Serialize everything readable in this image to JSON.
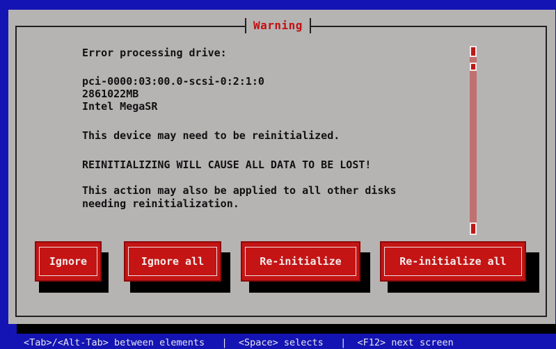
{
  "dialog": {
    "title": "Warning",
    "message_lines": [
      "Error processing drive:",
      "pci-0000:03:00.0-scsi-0:2:1:0",
      "2861022MB",
      "Intel MegaSR",
      "This device may need to be reinitialized.",
      "REINITIALIZING WILL CAUSE ALL DATA TO BE LOST!",
      "This action may also be applied to all other disks",
      "needing reinitialization."
    ]
  },
  "buttons": {
    "ignore": "Ignore",
    "ignore_all": "Ignore all",
    "reinitialize": "Re-initialize",
    "reinitialize_all": "Re-initialize all"
  },
  "status_bar": {
    "text": "<Tab>/<Alt-Tab> between elements   |  <Space> selects   |  <F12> next screen"
  },
  "colors": {
    "background": "#1414b4",
    "dialog": "#b6b3b3",
    "title": "#c01010",
    "button": "#c41414"
  }
}
